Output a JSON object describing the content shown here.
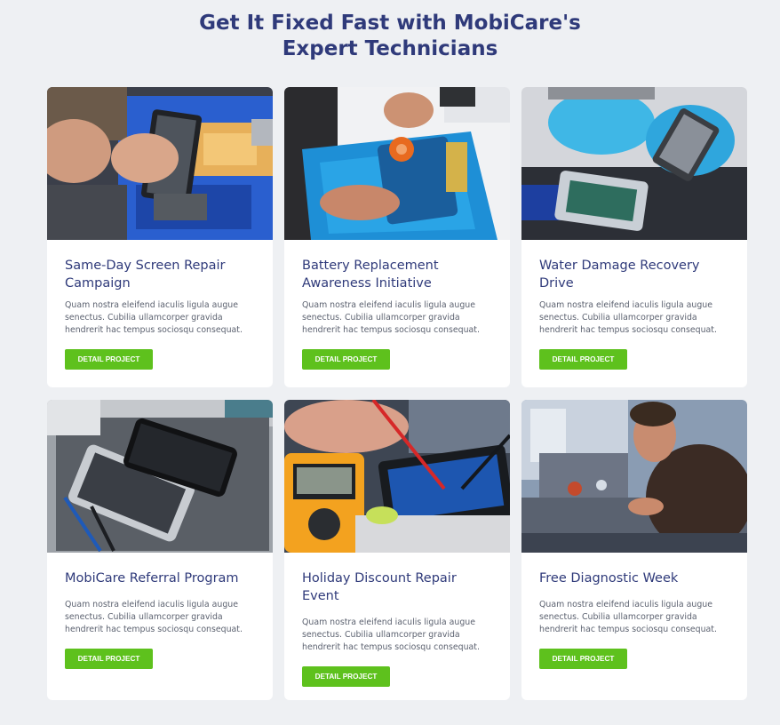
{
  "heading": {
    "line1": "Get It Fixed Fast with MobiCare's",
    "line2": "Expert Technicians"
  },
  "colors": {
    "background": "#eef0f3",
    "heading": "#2f3a7a",
    "button": "#5ec11d"
  },
  "cards": [
    {
      "image": "technician-repairing-phone-on-blue-mat",
      "title": "Same-Day Screen Repair Campaign",
      "description": "Quam nostra eleifend iaculis ligula augue senectus. Cubilia ullamcorper gravida hendrerit hac tempus sociosqu consequat.",
      "button": "DETAIL PROJECT"
    },
    {
      "image": "battery-replacement-suction-tool",
      "title": "Battery Replacement Awareness Initiative",
      "description": "Quam nostra eleifend iaculis ligula augue senectus. Cubilia ullamcorper gravida hendrerit hac tempus sociosqu consequat.",
      "button": "DETAIL PROJECT"
    },
    {
      "image": "gloved-hands-with-phone-board",
      "title": "Water Damage Recovery Drive",
      "description": "Quam nostra eleifend iaculis ligula augue senectus. Cubilia ullamcorper gravida hendrerit hac tempus sociosqu consequat.",
      "button": "DETAIL PROJECT"
    },
    {
      "image": "disassembled-phone-on-gray-mat",
      "title": "MobiCare Referral Program",
      "description": "Quam nostra eleifend iaculis ligula augue senectus. Cubilia ullamcorper gravida hendrerit hac tempus sociosqu consequat.",
      "button": "DETAIL PROJECT"
    },
    {
      "image": "multimeter-testing-circuit-board",
      "title": "Holiday Discount Repair Event",
      "description": "Quam nostra eleifend iaculis ligula augue senectus. Cubilia ullamcorper gravida hendrerit hac tempus sociosqu consequat.",
      "button": "DETAIL PROJECT"
    },
    {
      "image": "technician-soldering-at-workbench",
      "title": "Free Diagnostic Week",
      "description": "Quam nostra eleifend iaculis ligula augue senectus. Cubilia ullamcorper gravida hendrerit hac tempus sociosqu consequat.",
      "button": "DETAIL PROJECT"
    }
  ]
}
